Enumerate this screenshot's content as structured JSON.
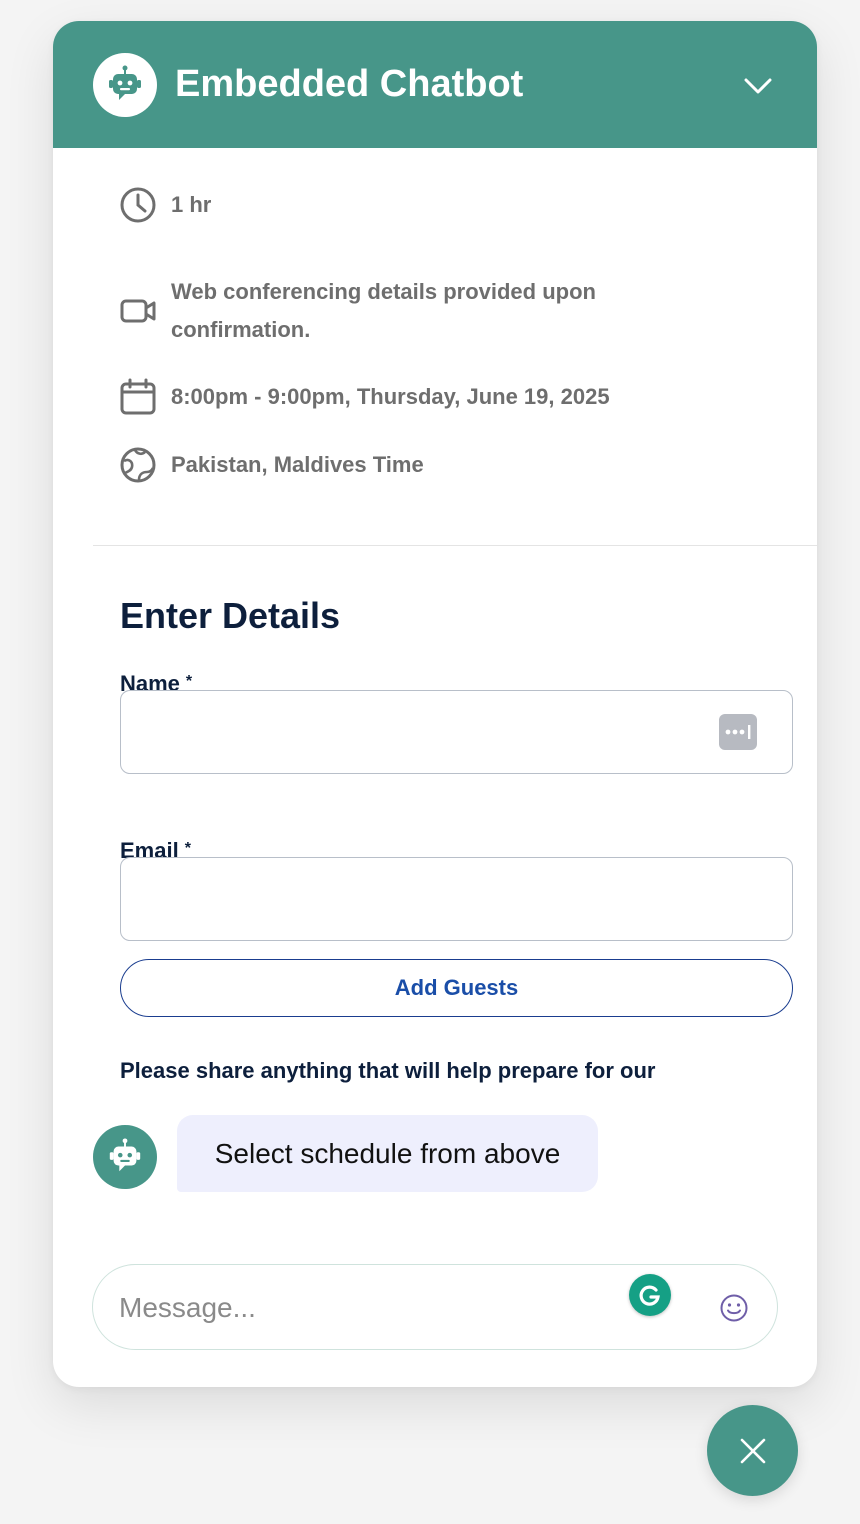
{
  "header": {
    "title": "Embedded Chatbot",
    "avatar_icon": "robot-icon",
    "collapse_icon": "chevron-down-icon",
    "color": "#479689"
  },
  "event": {
    "duration": "1 hr",
    "location": "Web conferencing details provided upon confirmation.",
    "datetime": "8:00pm - 9:00pm, Thursday, June 19, 2025",
    "timezone": "Pakistan, Maldives Time"
  },
  "form": {
    "title": "Enter Details",
    "name_label": "Name",
    "email_label": "Email",
    "required_mark": "*",
    "name_value": "",
    "email_value": "",
    "add_guests_label": "Add Guests",
    "notes_label": "Please share anything that will help prepare for our"
  },
  "chat": {
    "bot_message": "Select schedule from above",
    "message_placeholder": "Message...",
    "bubble_color": "#eeeffd"
  },
  "controls": {
    "emoji_icon": "smiley-icon",
    "grammarly_icon": "grammarly-icon",
    "close_icon": "close-icon"
  }
}
